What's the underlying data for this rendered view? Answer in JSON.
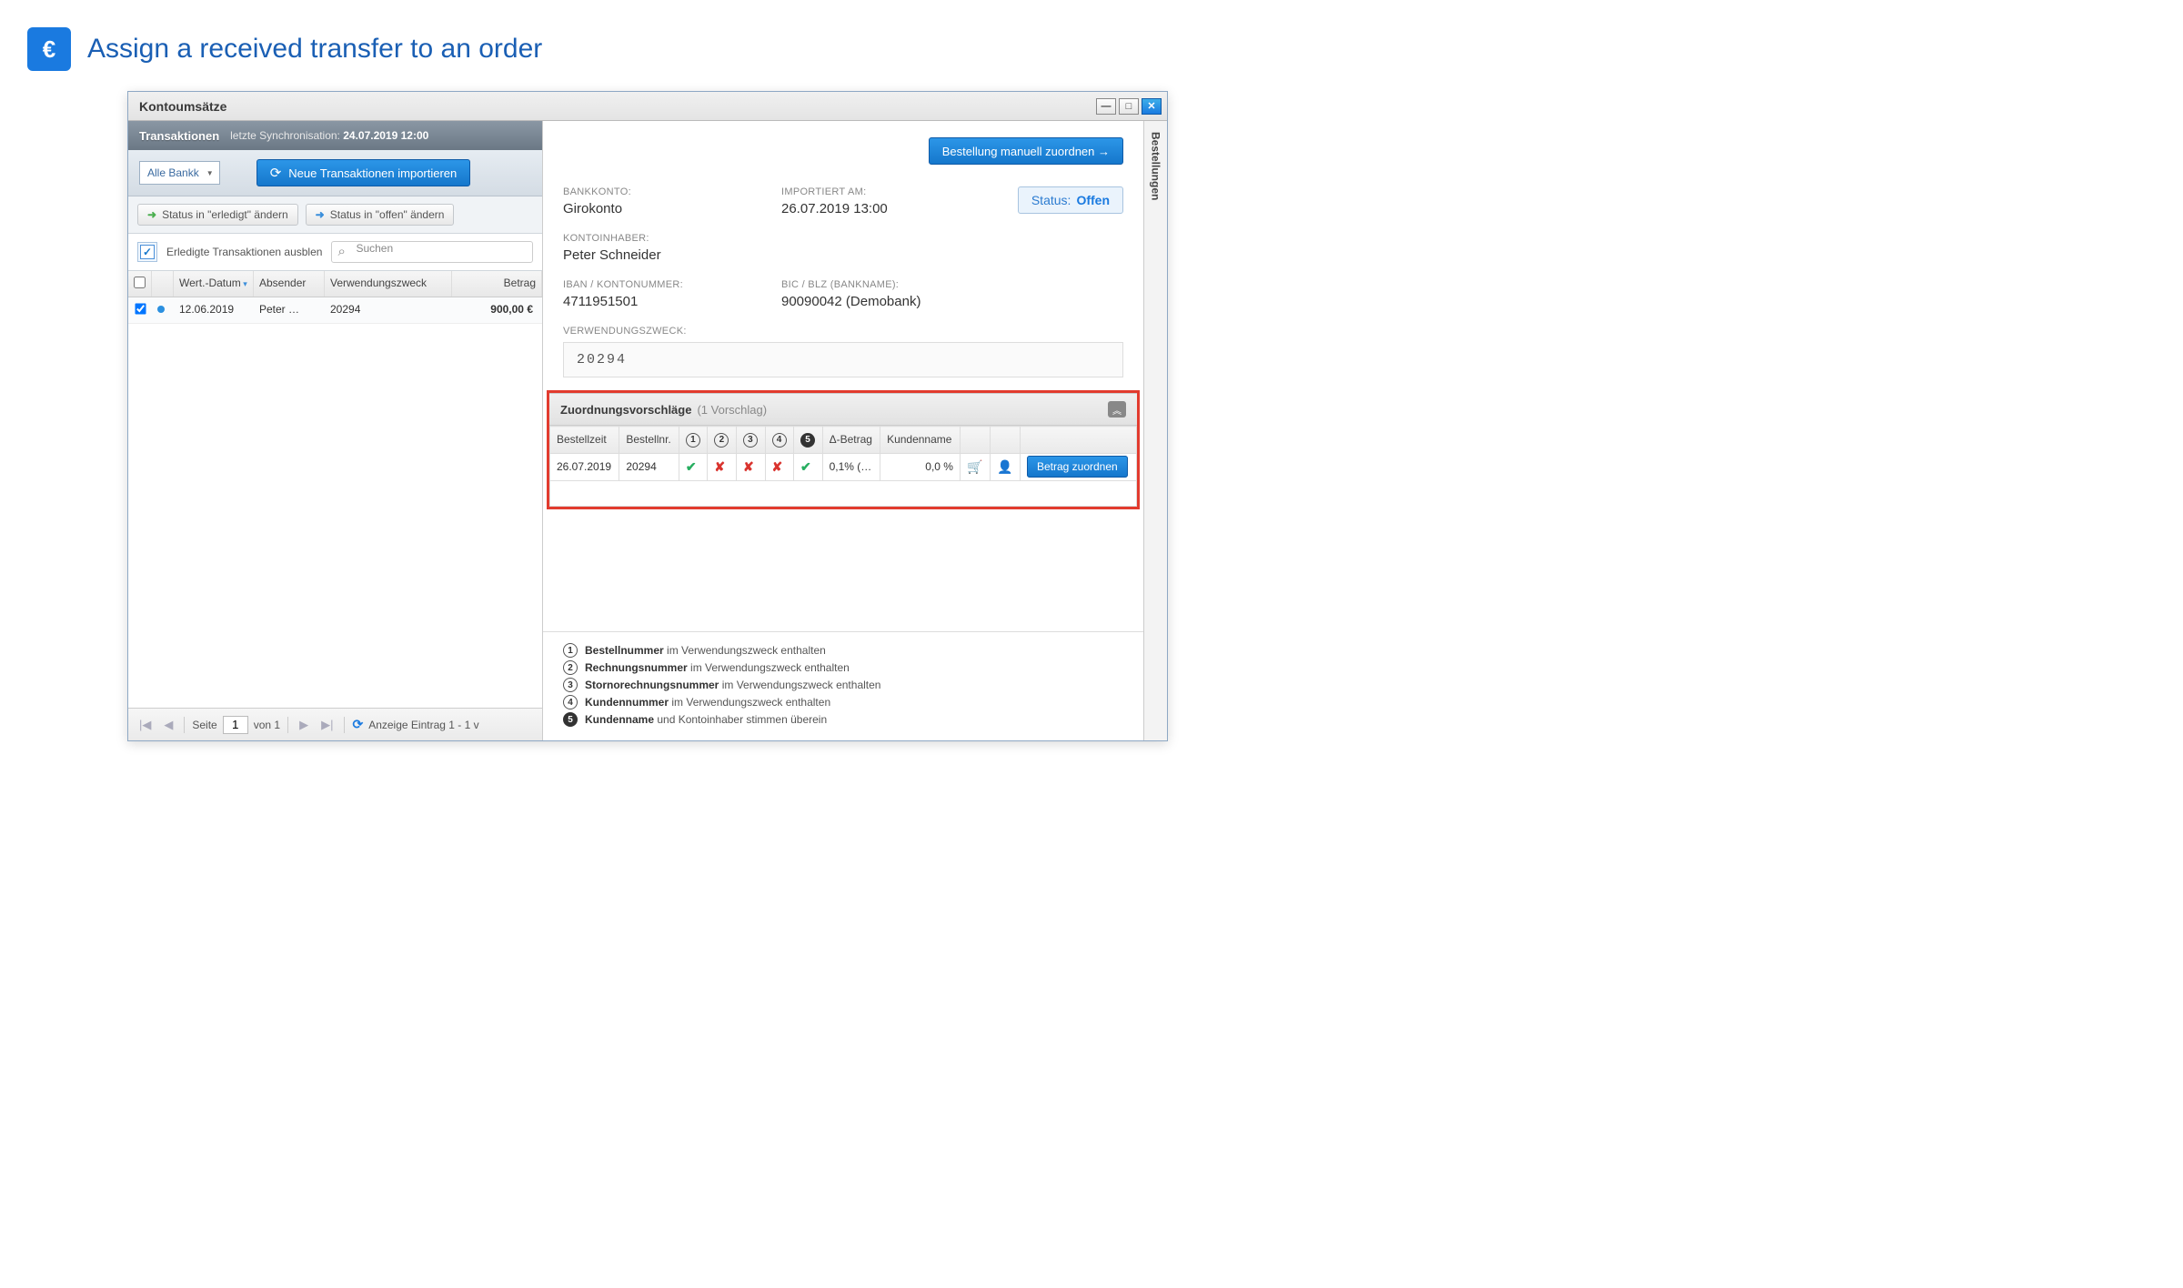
{
  "page_title": "Assign a received transfer to an order",
  "window": {
    "title": "Kontoumsätze",
    "side_tab": "Bestellungen"
  },
  "left": {
    "header_title": "Transaktionen",
    "sync_label": "letzte Synchronisation:",
    "sync_time": "24.07.2019 12:00",
    "account_dropdown": "Alle Bankk",
    "import_btn": "Neue Transaktionen importieren",
    "status_done_btn": "Status in \"erledigt\" ändern",
    "status_open_btn": "Status in \"offen\" ändern",
    "hide_done_label": "Erledigte Transaktionen ausblen",
    "search_placeholder": "Suchen",
    "columns": {
      "date": "Wert.-Datum",
      "sender": "Absender",
      "purpose": "Verwendungszweck",
      "amount": "Betrag"
    },
    "row": {
      "date": "12.06.2019",
      "sender": "Peter …",
      "purpose": "20294",
      "amount": "900,00 €"
    },
    "pager": {
      "page_label": "Seite",
      "page_value": "1",
      "of_label": "von 1",
      "display": "Anzeige Eintrag 1 - 1 v"
    }
  },
  "detail": {
    "assign_btn": "Bestellung manuell zuordnen  →",
    "bank_lbl": "BANKKONTO:",
    "bank_val": "Girokonto",
    "imported_lbl": "IMPORTIERT AM:",
    "imported_val": "26.07.2019 13:00",
    "status_lbl": "Status:",
    "status_val": "Offen",
    "holder_lbl": "KONTOINHABER:",
    "holder_val": "Peter Schneider",
    "iban_lbl": "IBAN / KONTONUMMER:",
    "iban_val": "4711951501",
    "bic_lbl": "BIC / BLZ (BANKNAME):",
    "bic_val": "90090042 (Demobank)",
    "purpose_lbl": "VERWENDUNGSZWECK:",
    "purpose_val": "20294"
  },
  "suggestions": {
    "title": "Zuordnungsvorschläge",
    "count": "(1 Vorschlag)",
    "cols": {
      "time": "Bestellzeit",
      "nr": "Bestellnr.",
      "delta": "Δ-Betrag",
      "customer": "Kundenname"
    },
    "row": {
      "time": "26.07.2019",
      "nr": "20294",
      "c1": "✔",
      "c2": "✘",
      "c3": "✘",
      "c4": "✘",
      "c5": "✔",
      "delta": "0,1% (…",
      "customer": "0,0 %",
      "assign_btn": "Betrag zuordnen"
    }
  },
  "legend": {
    "l1a": "Bestellnummer",
    "l1b": " im Verwendungszweck enthalten",
    "l2a": "Rechnungsnummer",
    "l2b": " im Verwendungszweck enthalten",
    "l3a": "Stornorechnungsnummer",
    "l3b": " im Verwendungszweck enthalten",
    "l4a": "Kundennummer",
    "l4b": " im Verwendungszweck enthalten",
    "l5a": "Kundenname",
    "l5b": " und Kontoinhaber stimmen überein"
  }
}
